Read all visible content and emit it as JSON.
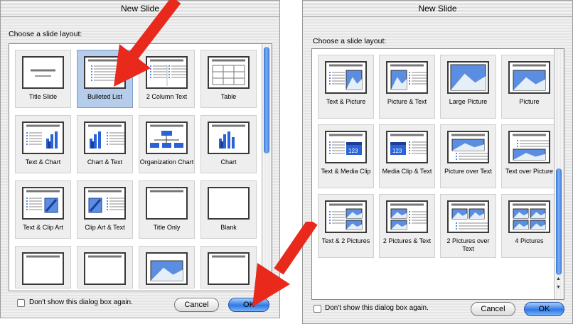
{
  "left_dialog": {
    "title": "New Slide",
    "choose_label": "Choose a slide layout:",
    "layouts": [
      {
        "label": "Title Slide",
        "icon": "title-slide",
        "selected": false
      },
      {
        "label": "Bulleted List",
        "icon": "bulleted-list",
        "selected": true
      },
      {
        "label": "2 Column Text",
        "icon": "two-column-text",
        "selected": false
      },
      {
        "label": "Table",
        "icon": "table",
        "selected": false
      },
      {
        "label": "Text & Chart",
        "icon": "text-chart",
        "selected": false
      },
      {
        "label": "Chart & Text",
        "icon": "chart-text",
        "selected": false
      },
      {
        "label": "Organization Chart",
        "icon": "org-chart",
        "selected": false
      },
      {
        "label": "Chart",
        "icon": "chart",
        "selected": false
      },
      {
        "label": "Text & Clip Art",
        "icon": "text-clipart",
        "selected": false
      },
      {
        "label": "Clip Art & Text",
        "icon": "clipart-text",
        "selected": false
      },
      {
        "label": "Title Only",
        "icon": "title-only",
        "selected": false
      },
      {
        "label": "Blank",
        "icon": "blank",
        "selected": false
      }
    ],
    "checkbox_label": "Don't show this dialog box again.",
    "cancel_label": "Cancel",
    "ok_label": "OK"
  },
  "right_dialog": {
    "title": "New Slide",
    "choose_label": "Choose a slide layout:",
    "layouts": [
      {
        "label": "Text & Picture",
        "icon": "text-picture"
      },
      {
        "label": "Picture & Text",
        "icon": "picture-text"
      },
      {
        "label": "Large Picture",
        "icon": "large-picture"
      },
      {
        "label": "Picture",
        "icon": "picture"
      },
      {
        "label": "Text & Media Clip",
        "icon": "text-media"
      },
      {
        "label": "Media Clip & Text",
        "icon": "media-text"
      },
      {
        "label": "Picture over Text",
        "icon": "picture-over-text"
      },
      {
        "label": "Text over Picture",
        "icon": "text-over-picture"
      },
      {
        "label": "Text & 2 Pictures",
        "icon": "text-2-pictures"
      },
      {
        "label": "2 Pictures & Text",
        "icon": "2-pictures-text"
      },
      {
        "label": "2 Pictures over Text",
        "icon": "2-pictures-over-text"
      },
      {
        "label": "4 Pictures",
        "icon": "4-pictures"
      }
    ],
    "checkbox_label": "Don't show this dialog box again.",
    "cancel_label": "Cancel",
    "ok_label": "OK"
  },
  "colors": {
    "annotation_arrow": "#e8291c",
    "selection": "#b5cdea",
    "ok_button": "#2f78e6"
  }
}
